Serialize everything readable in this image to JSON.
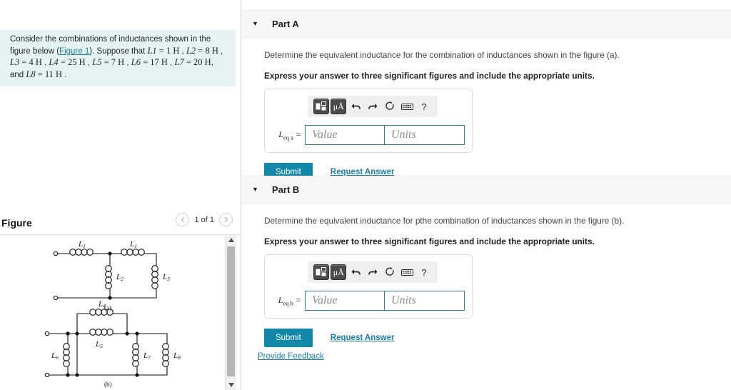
{
  "problem": {
    "text_before_link": "Consider the combinations of inductances shown in the figure below (",
    "figure_link": "Figure 1",
    "text_after_link": "). Suppose that ",
    "inductances": [
      {
        "symbol": "L",
        "index": "1",
        "value": "1",
        "unit": "H"
      },
      {
        "symbol": "L",
        "index": "2",
        "value": "8",
        "unit": "H"
      },
      {
        "symbol": "L",
        "index": "3",
        "value": "4",
        "unit": "H"
      },
      {
        "symbol": "L",
        "index": "4",
        "value": "25",
        "unit": "H"
      },
      {
        "symbol": "L",
        "index": "5",
        "value": "7",
        "unit": "H"
      },
      {
        "symbol": "L",
        "index": "6",
        "value": "17",
        "unit": "H"
      },
      {
        "symbol": "L",
        "index": "7",
        "value": "20",
        "unit": "H"
      },
      {
        "symbol": "L",
        "index": "8",
        "value": "11",
        "unit": "H"
      }
    ],
    "separator": " , ",
    "and_word": ", and ",
    "period": " ."
  },
  "figure_panel": {
    "title": "Figure",
    "count_label": "1 of 1",
    "prev_icon": "chevron-left-icon",
    "next_icon": "chevron-right-icon",
    "diagram_a_caption": "(a)",
    "diagram_b_caption": "(b)",
    "diagram_a_labels": [
      "L₁",
      "L₁",
      "L₂",
      "L₃"
    ],
    "diagram_b_labels": [
      "L₄",
      "L₅",
      "L₆",
      "L₇",
      "L₈"
    ]
  },
  "parts": [
    {
      "id": "part-a",
      "title": "Part A",
      "caret": "▼",
      "prompt": "Determine the equivalent inductance for the combination of inductances shown in the figure (a).",
      "prompt_bold": "Express your answer to three significant figures and include the appropriate units.",
      "answer_label_base": "L",
      "answer_label_sub": "eq a",
      "answer_label_eq": "=",
      "value_placeholder": "Value",
      "units_placeholder": "Units",
      "value_current": "",
      "units_current": "",
      "submit_label": "Submit",
      "request_answer_label": "Request Answer"
    },
    {
      "id": "part-b",
      "title": "Part B",
      "caret": "▼",
      "prompt": "Determine the equivalent inductance for pthe combination of inductances shown in the figure (b).",
      "prompt_bold": "Express your answer to three significant figures and include the appropriate units.",
      "answer_label_base": "L",
      "answer_label_sub": "eq b",
      "answer_label_eq": "=",
      "value_placeholder": "Value",
      "units_placeholder": "Units",
      "value_current": "",
      "units_current": "",
      "submit_label": "Submit",
      "request_answer_label": "Request Answer"
    }
  ],
  "toolbar": {
    "template_icon": "math-template-icon",
    "units_icon": "micro-angstrom-units-icon",
    "units_label": "μÅ",
    "undo_icon": "undo-arrow-icon",
    "redo_icon": "redo-arrow-icon",
    "reset_icon": "reset-circle-icon",
    "keyboard_icon": "keyboard-icon",
    "help_icon": "help-question-icon",
    "help_label": "?"
  },
  "footer": {
    "provide_feedback_label": "Provide Feedback"
  },
  "colors": {
    "accent_teal": "#1287a8",
    "link_blue": "#1a7fa8",
    "problem_box_bg": "#e6f3f1",
    "field_border": "#2b7f9e",
    "header_bg": "#f7f7f7"
  },
  "scrollbar": {
    "up_icon": "scroll-up-arrow-icon",
    "down_icon": "scroll-down-arrow-icon"
  }
}
